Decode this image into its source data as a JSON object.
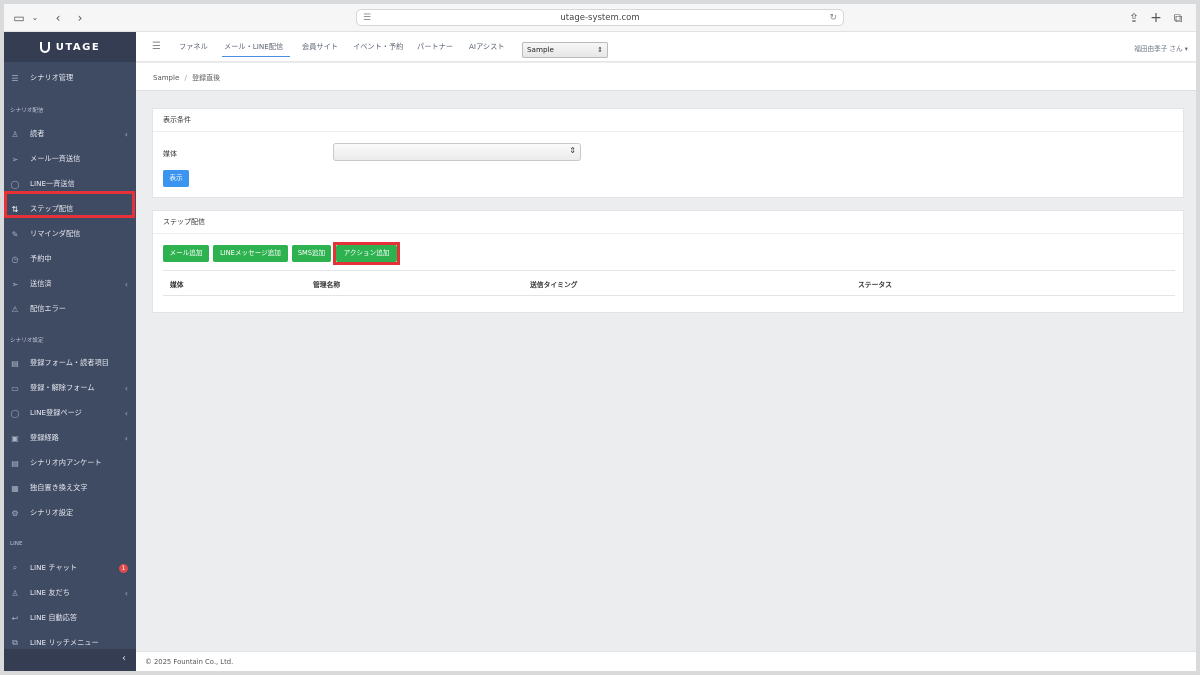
{
  "browser": {
    "url": "utage-system.com"
  },
  "sidebar": {
    "brand": "UTAGE",
    "top_item": "シナリオ管理",
    "section1": "シナリオ配信",
    "section2": "シナリオ設定",
    "section3": "LINE",
    "items": [
      {
        "label": "読者",
        "icon": "reader-icon",
        "chevron": "‹"
      },
      {
        "label": "メール一斉送信",
        "icon": "send-icon"
      },
      {
        "label": "LINE一斉送信",
        "icon": "chat-icon"
      },
      {
        "label": "ステップ配信",
        "icon": "sort-icon"
      },
      {
        "label": "リマインダ配信",
        "icon": "pencil-icon"
      },
      {
        "label": "予約中",
        "icon": "clock-icon"
      },
      {
        "label": "送信済",
        "icon": "sent-icon",
        "chevron": "‹"
      },
      {
        "label": "配信エラー",
        "icon": "warning-icon"
      },
      {
        "label": "登録フォーム・読者項目",
        "icon": "table-icon"
      },
      {
        "label": "登録・解除フォーム",
        "icon": "form-icon",
        "chevron": "‹"
      },
      {
        "label": "LINE登録ページ",
        "icon": "chat-icon",
        "chevron": "‹"
      },
      {
        "label": "登録経路",
        "icon": "route-icon",
        "chevron": "‹"
      },
      {
        "label": "シナリオ内アンケート",
        "icon": "survey-icon"
      },
      {
        "label": "独自置き換え文字",
        "icon": "text-icon"
      },
      {
        "label": "シナリオ設定",
        "icon": "gear-icon"
      },
      {
        "label": "LINE チャット",
        "icon": "chat-bubble-icon",
        "badge": "1"
      },
      {
        "label": "LINE 友だち",
        "icon": "user-icon",
        "chevron": "‹"
      },
      {
        "label": "LINE 自動応答",
        "icon": "reply-icon"
      },
      {
        "label": "LINE リッチメニュー",
        "icon": "menu-icon"
      }
    ],
    "collapse_glyph": "‹"
  },
  "topnav": {
    "items": [
      "ファネル",
      "メール・LINE配信",
      "会員サイト",
      "イベント・予約",
      "パートナー",
      "AIアシスト"
    ],
    "project_select": "Sample",
    "user": "福田由季子 さん ▾"
  },
  "breadcrumb": {
    "root": "Sample",
    "separator": "/",
    "current": "登録直後"
  },
  "filter_card": {
    "title": "表示条件",
    "field_label": "媒体",
    "select_value": "",
    "show_button": "表示"
  },
  "step_card": {
    "title": "ステップ配信",
    "buttons": [
      "メール追加",
      "LINEメッセージ追加",
      "SMS追加",
      "アクション追加"
    ],
    "columns": [
      "媒体",
      "管理名称",
      "送信タイミング",
      "ステータス"
    ]
  },
  "footer": {
    "copyright": "© 2025 Fountain Co., Ltd."
  },
  "colors": {
    "sidebar_bg": "#3f4a63",
    "highlight": "#e53238",
    "btn_green": "#2eb250",
    "btn_blue": "#3b94f0"
  }
}
